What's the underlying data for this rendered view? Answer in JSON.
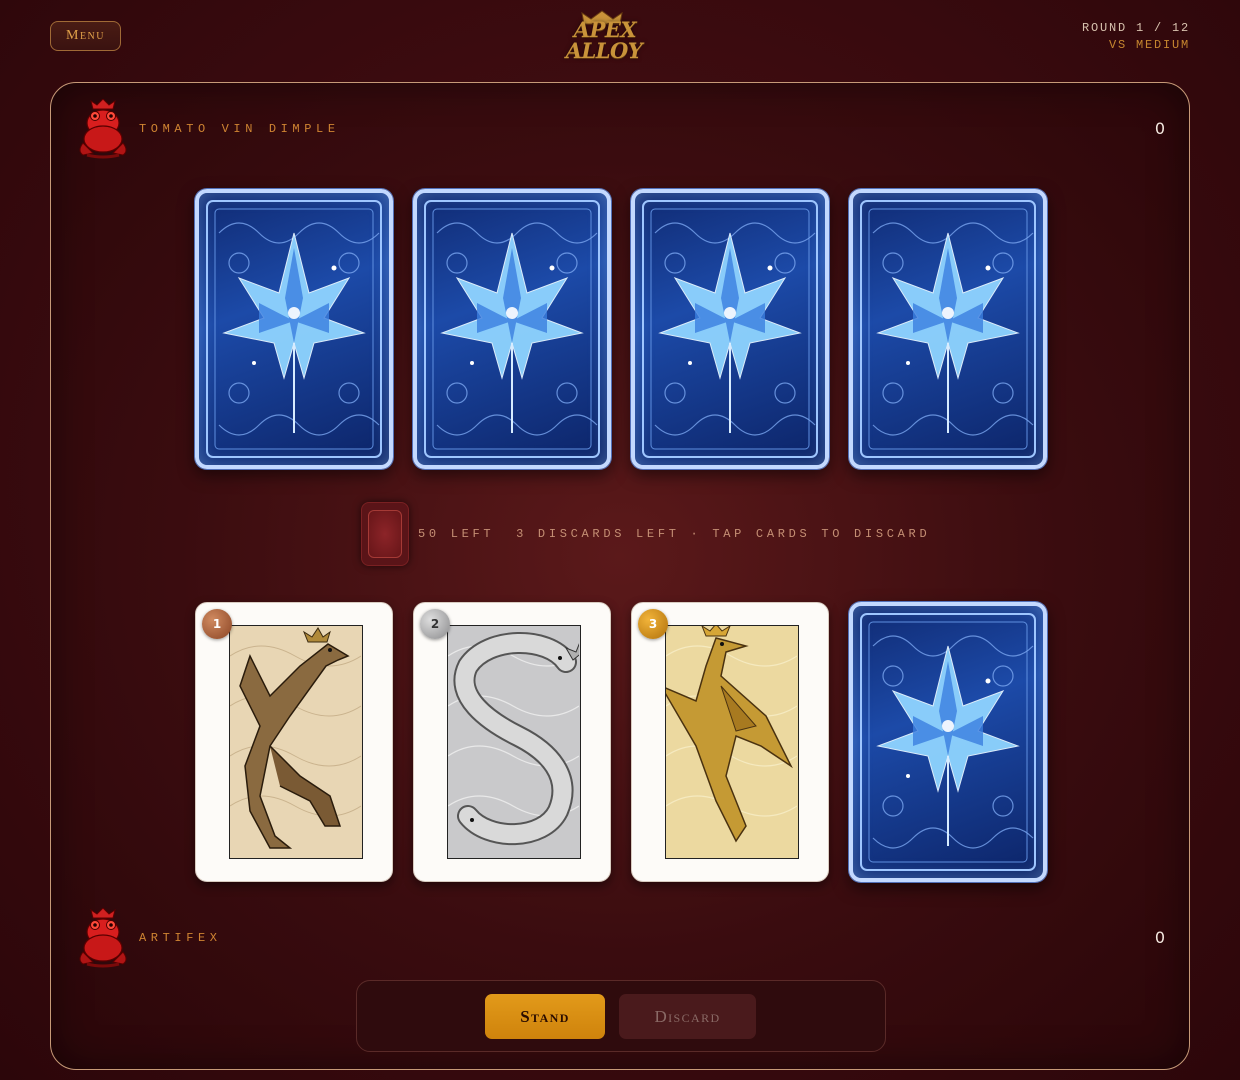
{
  "header": {
    "menu_label": "Menu",
    "logo_line1": "APEX",
    "logo_line2": "ALLOY",
    "round_text": "ROUND 1 / 12",
    "opponent_text": "VS MEDIUM"
  },
  "opponent": {
    "name": "TOMATO VIN DIMPLE",
    "score": "0",
    "avatar_icon": "red-crowned-frog-icon",
    "hand": [
      {
        "face_down": true
      },
      {
        "face_down": true
      },
      {
        "face_down": true
      },
      {
        "face_down": true
      }
    ]
  },
  "deck": {
    "status_text": "50 LEFT  3 DISCARDS LEFT · TAP CARDS TO DISCARD"
  },
  "player": {
    "name": "ARTIFEX",
    "score": "0",
    "avatar_icon": "red-crowned-frog-icon",
    "hand": [
      {
        "rank": "1",
        "metal": "bronze",
        "badge_color": "#a85b35",
        "art": "crowned-wolf"
      },
      {
        "rank": "2",
        "metal": "silver",
        "badge_color": "#a8a8aa",
        "art": "crowned-catfish"
      },
      {
        "rank": "3",
        "metal": "gold",
        "badge_color": "#d18e18",
        "art": "crowned-raven"
      },
      {
        "face_down": true
      }
    ]
  },
  "actions": {
    "stand_label": "Stand",
    "discard_label": "Discard"
  },
  "colors": {
    "accent": "#e29a1a",
    "text_orange": "#cf8432",
    "board_border": "#c79a78",
    "card_back_blue": "#1c4aa8"
  }
}
